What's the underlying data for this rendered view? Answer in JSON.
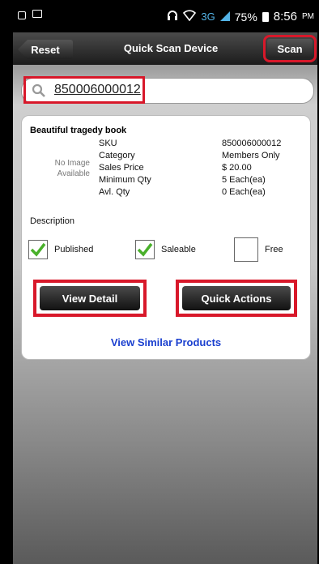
{
  "status_bar": {
    "network": "3G",
    "battery": "75%",
    "time": "8:56",
    "ampm": "PM"
  },
  "titlebar": {
    "reset_label": "Reset",
    "title": "Quick Scan Device",
    "scan_label": "Scan"
  },
  "search": {
    "value": "850006000012"
  },
  "product": {
    "name": "Beautiful tragedy book",
    "no_image_text": "No Image Available",
    "fields": [
      {
        "label": "SKU",
        "value": "850006000012"
      },
      {
        "label": "Category",
        "value": "Members Only"
      },
      {
        "label": "Sales Price",
        "value": "$ 20.00"
      },
      {
        "label": "Minimum Qty",
        "value": "5 Each(ea)"
      },
      {
        "label": "Avl. Qty",
        "value": "0 Each(ea)"
      }
    ],
    "description_label": "Description",
    "checks": [
      {
        "label": "Published",
        "checked": true
      },
      {
        "label": "Saleable",
        "checked": true
      },
      {
        "label": "Free",
        "checked": false
      }
    ]
  },
  "actions": {
    "view_detail": "View Detail",
    "quick_actions": "Quick Actions",
    "view_similar": "View Similar Products"
  },
  "colors": {
    "highlight": "#d8182a",
    "link": "#1a3fcf",
    "check_green": "#49b02a",
    "network_blue": "#53b3e6"
  }
}
